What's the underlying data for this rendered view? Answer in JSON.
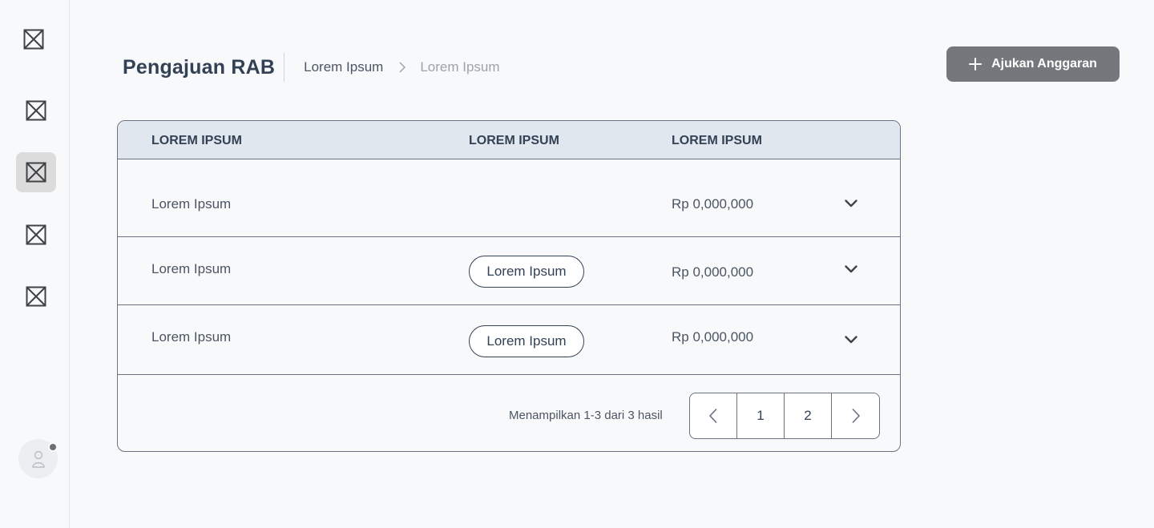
{
  "sidebar": {
    "items": [
      {
        "icon": "placeholder-icon"
      },
      {
        "icon": "placeholder-icon"
      },
      {
        "icon": "placeholder-icon",
        "active": true
      },
      {
        "icon": "placeholder-icon"
      },
      {
        "icon": "placeholder-icon"
      }
    ],
    "avatar_icon": "user-icon"
  },
  "header": {
    "title": "Pengajuan RAB",
    "breadcrumb": [
      "Lorem Ipsum",
      "Lorem Ipsum"
    ]
  },
  "actions": {
    "submit_budget_label": "Ajukan Anggaran",
    "submit_budget_icon": "plus-icon"
  },
  "table": {
    "columns": [
      "LOREM IPSUM",
      "LOREM IPSUM",
      "LOREM IPSUM"
    ],
    "rows": [
      {
        "name": "Lorem Ipsum",
        "status": "",
        "amount": "Rp 0,000,000"
      },
      {
        "name": "Lorem Ipsum",
        "status": "Lorem Ipsum",
        "amount": "Rp 0,000,000"
      },
      {
        "name": "Lorem Ipsum",
        "status": "Lorem Ipsum",
        "amount": "Rp 0,000,000"
      }
    ],
    "summary": "Menampilkan 1-3 dari 3 hasil",
    "pages": [
      "1",
      "2"
    ]
  },
  "colors": {
    "accent_button": "#74787d",
    "header_row": "#e1e7ef",
    "background": "#f8f9fb"
  }
}
